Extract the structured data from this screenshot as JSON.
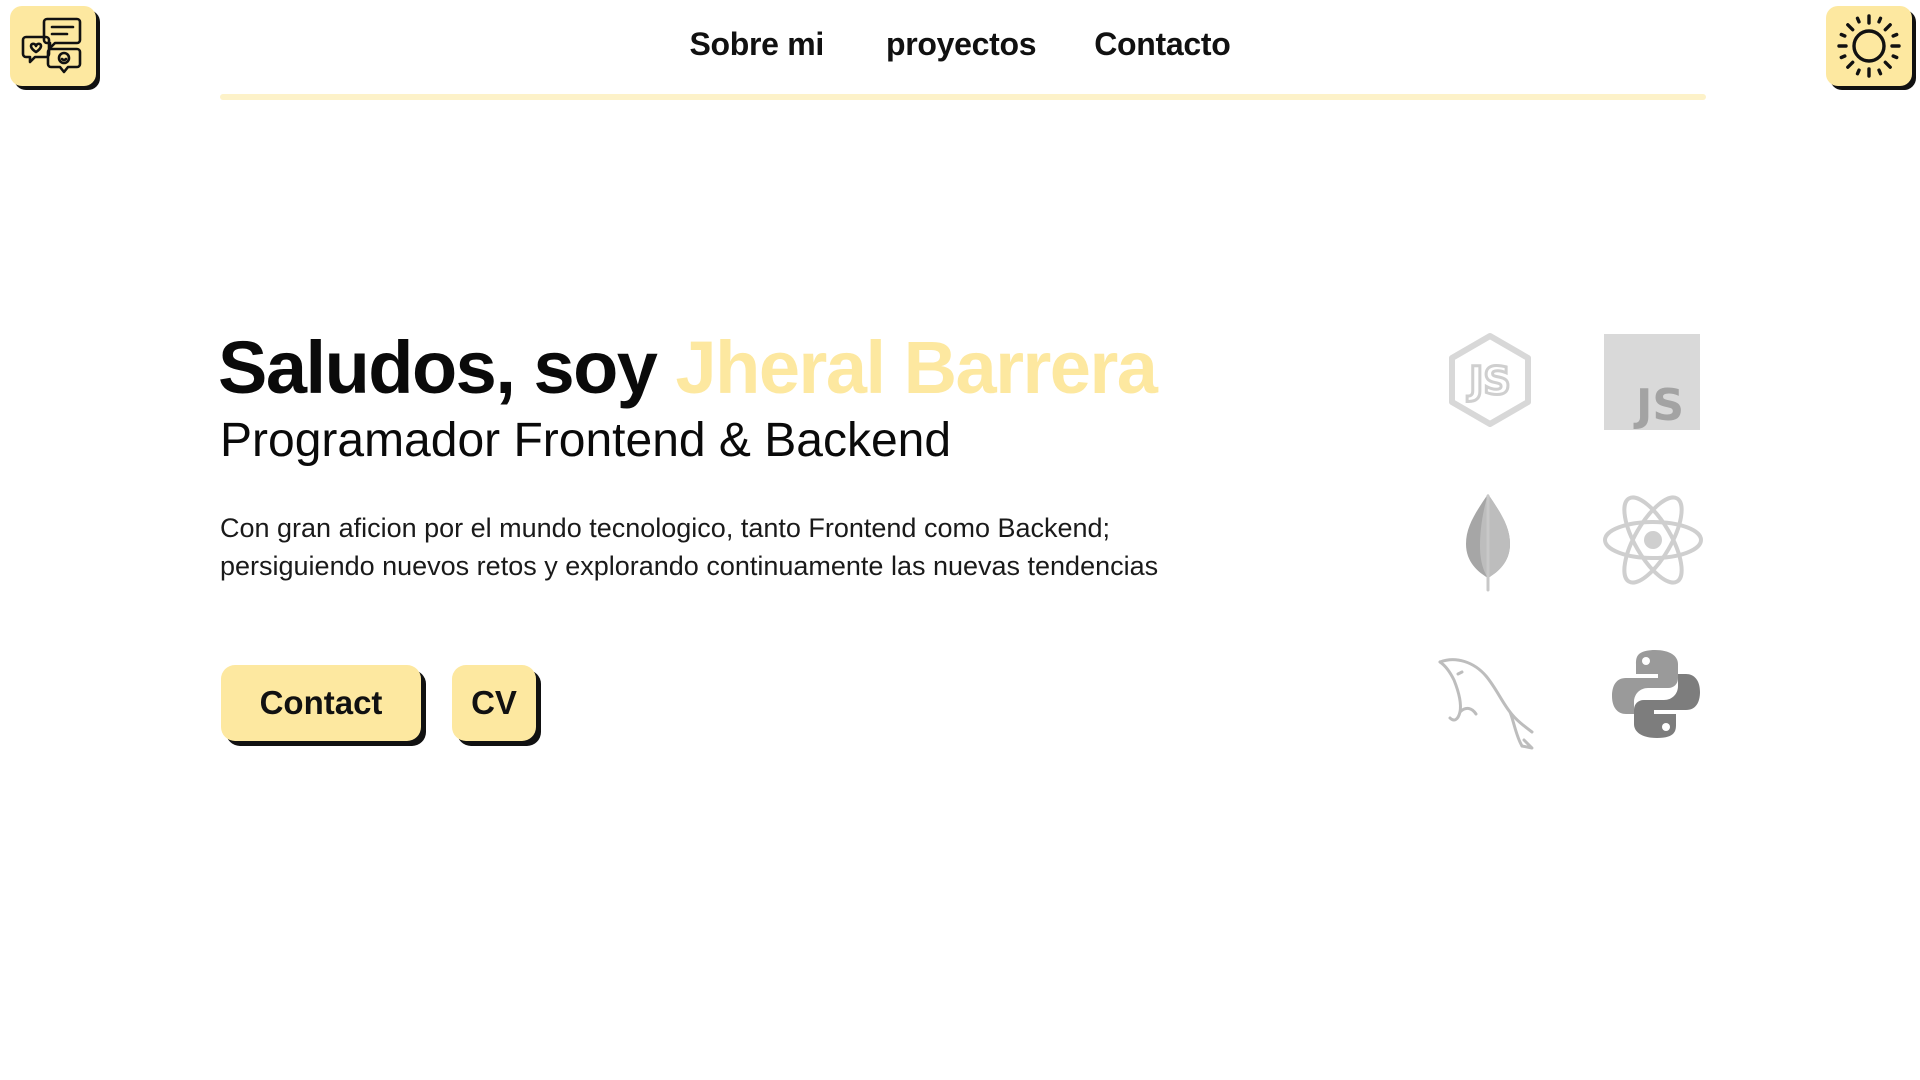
{
  "header": {
    "logo_icon": "chat-bubbles-icon",
    "theme_icon": "sun-icon",
    "nav": [
      {
        "label": "Sobre mi"
      },
      {
        "label": "proyectos"
      },
      {
        "label": "Contacto"
      }
    ]
  },
  "hero": {
    "greeting": "Saludos, soy",
    "name": "Jheral Barrera",
    "subtitle": "Programador Frontend & Backend",
    "description": "Con gran aficion por el mundo tecnologico, tanto Frontend como Backend; persiguiendo nuevos retos y explorando continuamente las nuevas tendencias",
    "buttons": {
      "contact": "Contact",
      "cv": "CV"
    }
  },
  "tech_icons": [
    {
      "icon": "nodejs-icon",
      "label": "JS"
    },
    {
      "icon": "javascript-icon",
      "label": "JS"
    },
    {
      "icon": "mongodb-icon"
    },
    {
      "icon": "react-icon"
    },
    {
      "icon": "mysql-icon"
    },
    {
      "icon": "python-icon"
    }
  ],
  "colors": {
    "accent": "#fde8a0",
    "rule": "#fdf2c9",
    "text": "#0a0a0a",
    "icon_gray": "#9e9e9e"
  }
}
